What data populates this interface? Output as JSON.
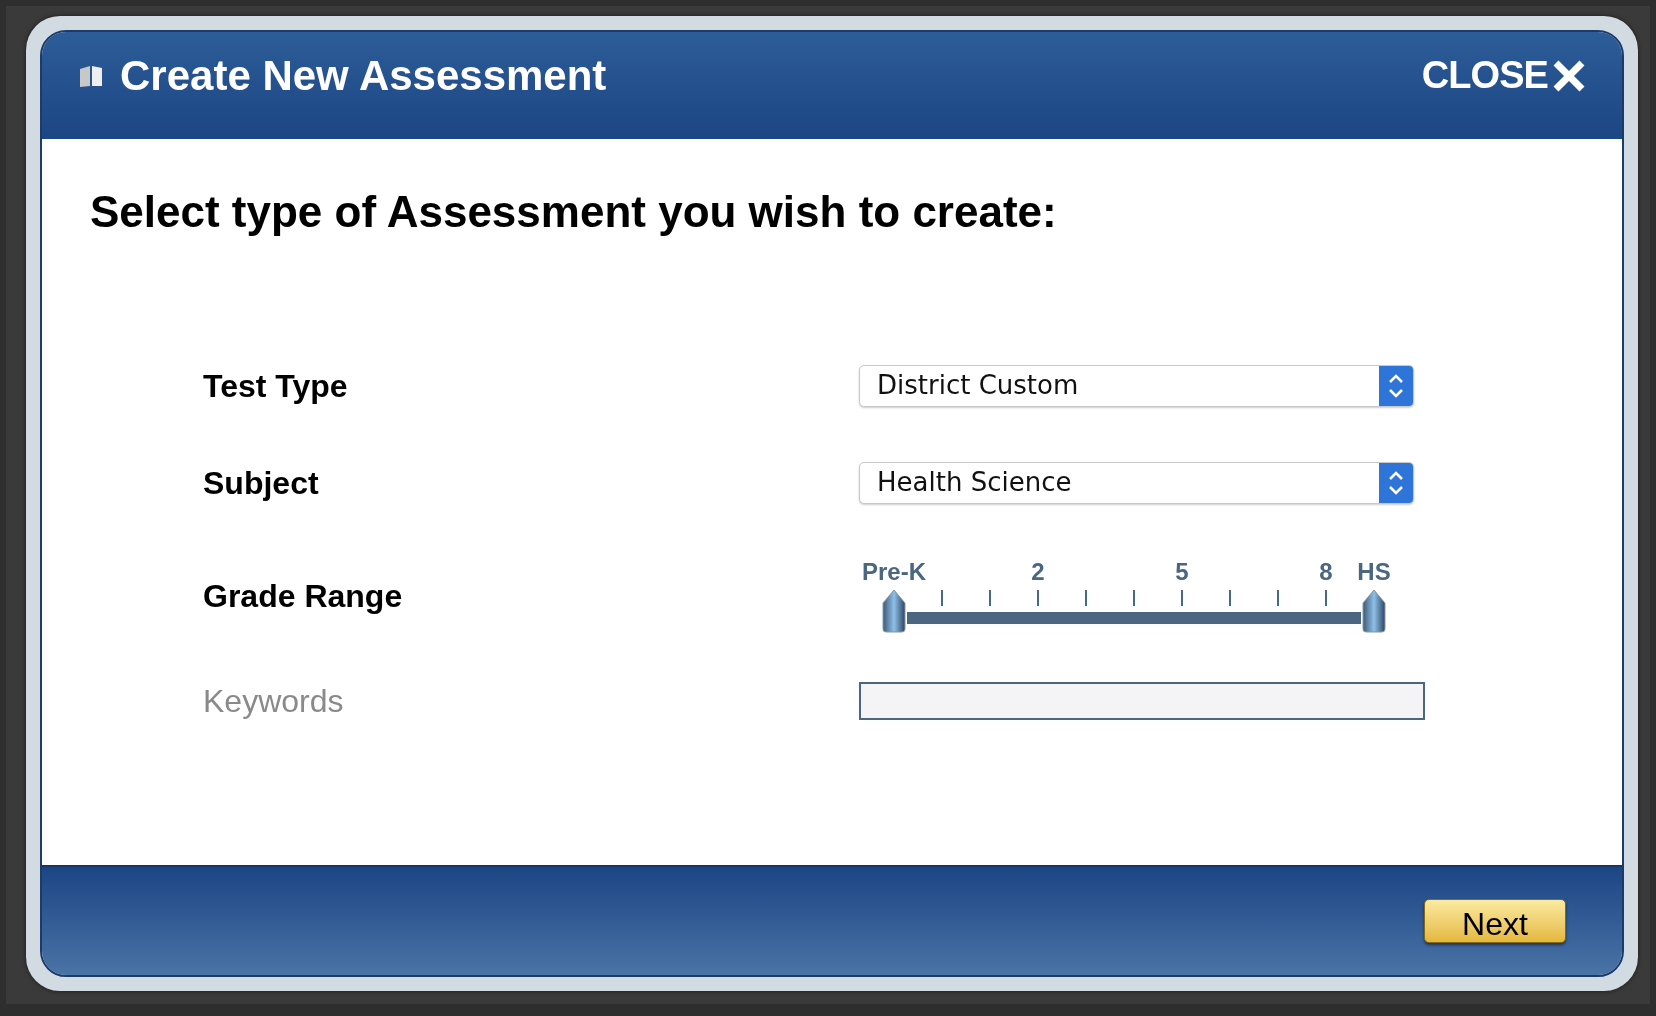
{
  "dialog": {
    "title": "Create New Assessment",
    "close_label": "CLOSE"
  },
  "heading": "Select type of Assessment you wish to create:",
  "fields": [
    {
      "kind": "select",
      "label": "Test Type",
      "value": "District Custom",
      "disabled": false
    },
    {
      "kind": "select",
      "label": "Subject",
      "value": "Health Science",
      "disabled": false
    },
    {
      "kind": "range",
      "label": "Grade Range",
      "disabled": false,
      "scale": [
        {
          "label": "Pre-K"
        },
        {
          "label": "2"
        },
        {
          "label": "5"
        },
        {
          "label": "8"
        },
        {
          "label": "HS"
        }
      ],
      "handles": [
        {
          "level": 0
        },
        {
          "level": 1
        }
      ]
    },
    {
      "kind": "text",
      "label": "Keywords",
      "disabled": true
    }
  ],
  "buttons": [
    {
      "label": "Next"
    }
  ]
}
